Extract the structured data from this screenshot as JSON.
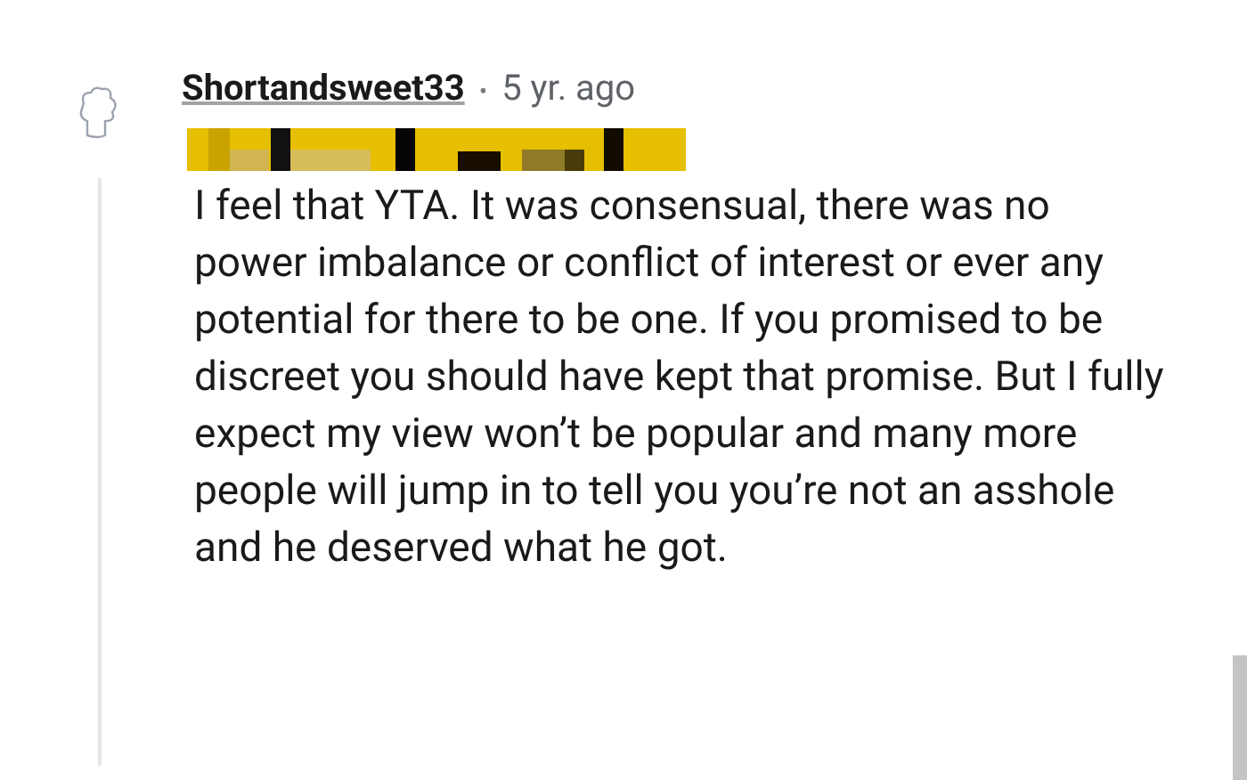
{
  "comment": {
    "username": "Shortandsweet33",
    "separator": "•",
    "time": "5 yr. ago",
    "body": "I feel that YTA. It was consensual, there was no power imbalance or conflict of interest or ever any potential for there to be one. If you promised to be discreet you should have kept that promise. But I fully expect my view won’t be popular and many more people will jump in to tell you you’re not an asshole and he deserved what he got."
  }
}
